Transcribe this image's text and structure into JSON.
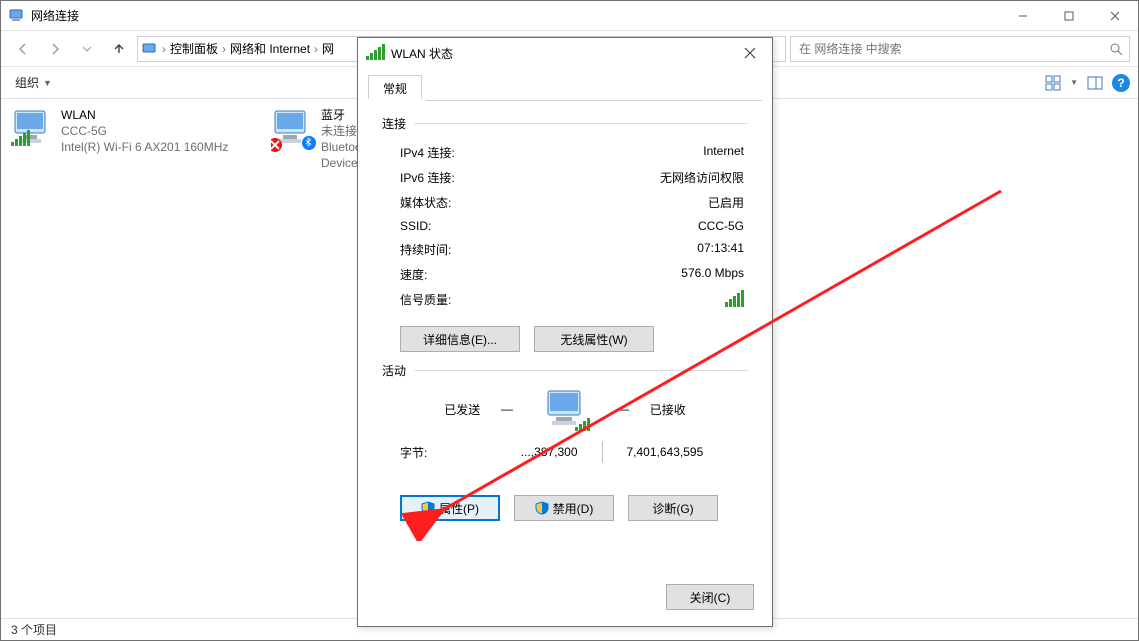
{
  "window": {
    "title": "网络连接",
    "min_tip": "最小化",
    "max_tip": "最大化",
    "close_tip": "关闭"
  },
  "breadcrumb": {
    "root": "控制面板",
    "mid": "网络和 Internet",
    "leaf": "网"
  },
  "search": {
    "placeholder": "在 网络连接 中搜索"
  },
  "toolbar": {
    "organize": "组织",
    "view_tip": "更改视图",
    "preview_tip": "显示预览窗格",
    "help_tip": "帮助"
  },
  "adapters": [
    {
      "name": "WLAN",
      "ssid": "CCC-5G",
      "device": "Intel(R) Wi-Fi 6 AX201 160MHz"
    },
    {
      "name": "蓝牙",
      "line2": "未连接",
      "line3": "Bluetooth Device"
    }
  ],
  "status": {
    "text": "3 个项目"
  },
  "dialog": {
    "title": "WLAN 状态",
    "tab": "常规",
    "group_conn": "连接",
    "rows": {
      "ipv4_k": "IPv4 连接:",
      "ipv4_v": "Internet",
      "ipv6_k": "IPv6 连接:",
      "ipv6_v": "无网络访问权限",
      "media_k": "媒体状态:",
      "media_v": "已启用",
      "ssid_k": "SSID:",
      "ssid_v": "CCC-5G",
      "dur_k": "持续时间:",
      "dur_v": "07:13:41",
      "speed_k": "速度:",
      "speed_v": "576.0 Mbps",
      "sig_k": "信号质量:"
    },
    "btn_details": "详细信息(E)...",
    "btn_wireless": "无线属性(W)",
    "group_activity": "活动",
    "sent_label": "已发送",
    "recv_label": "已接收",
    "bytes_label": "字节:",
    "bytes_sent": "...,387,300",
    "bytes_recv": "7,401,643,595",
    "btn_props": "属性(P)",
    "btn_disable": "禁用(D)",
    "btn_diag": "诊断(G)",
    "btn_close": "关闭(C)"
  }
}
